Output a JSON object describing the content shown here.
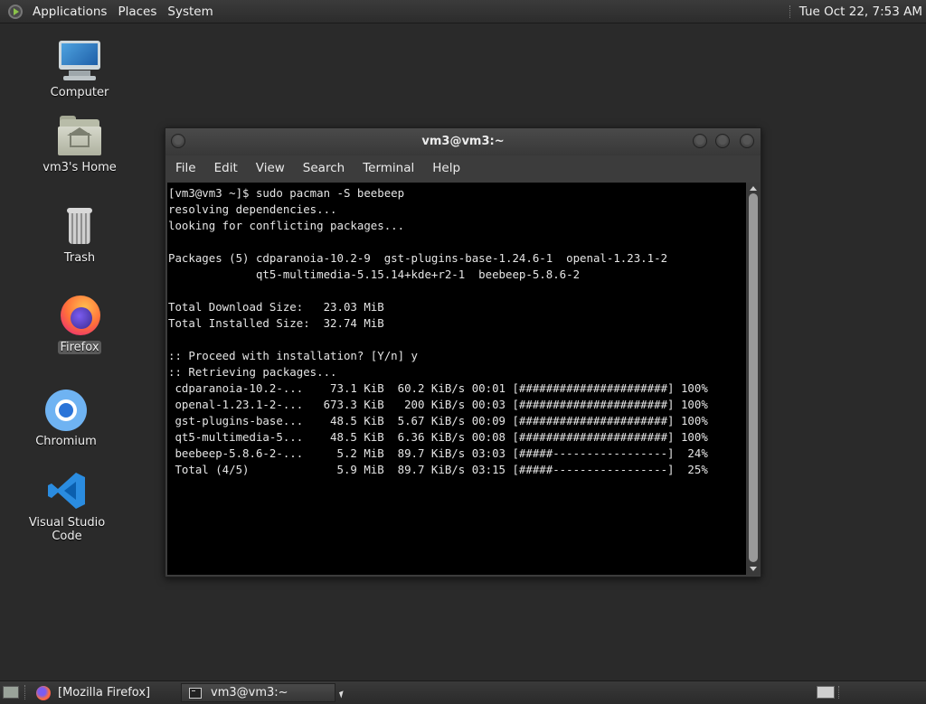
{
  "top_panel": {
    "menus": [
      "Applications",
      "Places",
      "System"
    ],
    "clock": "Tue Oct 22,  7:53 AM"
  },
  "desktop": {
    "icons": [
      {
        "label": "Computer",
        "icon": "computer-icon"
      },
      {
        "label": "vm3's Home",
        "icon": "home-folder-icon"
      },
      {
        "label": "Trash",
        "icon": "trash-icon"
      },
      {
        "label": "Firefox",
        "icon": "firefox-icon"
      },
      {
        "label": "Chromium",
        "icon": "chromium-icon"
      },
      {
        "label": "Visual Studio Code",
        "icon": "vscode-icon"
      }
    ]
  },
  "terminal": {
    "title": "vm3@vm3:~",
    "menu": [
      "File",
      "Edit",
      "View",
      "Search",
      "Terminal",
      "Help"
    ],
    "lines": [
      "[vm3@vm3 ~]$ sudo pacman -S beebeep",
      "resolving dependencies...",
      "looking for conflicting packages...",
      "",
      "Packages (5) cdparanoia-10.2-9  gst-plugins-base-1.24.6-1  openal-1.23.1-2",
      "             qt5-multimedia-5.15.14+kde+r2-1  beebeep-5.8.6-2",
      "",
      "Total Download Size:   23.03 MiB",
      "Total Installed Size:  32.74 MiB",
      "",
      ":: Proceed with installation? [Y/n] y",
      ":: Retrieving packages...",
      " cdparanoia-10.2-...    73.1 KiB  60.2 KiB/s 00:01 [######################] 100%",
      " openal-1.23.1-2-...   673.3 KiB   200 KiB/s 00:03 [######################] 100%",
      " gst-plugins-base...    48.5 KiB  5.67 KiB/s 00:09 [######################] 100%",
      " qt5-multimedia-5...    48.5 KiB  6.36 KiB/s 00:08 [######################] 100%",
      " beebeep-5.8.6-2-...     5.2 MiB  89.7 KiB/s 03:03 [#####-----------------]  24%",
      " Total (4/5)             5.9 MiB  89.7 KiB/s 03:15 [#####-----------------]  25%"
    ]
  },
  "taskbar": {
    "tasks": [
      {
        "label": "[Mozilla Firefox]",
        "icon": "firefox-icon",
        "active": false
      },
      {
        "label": "vm3@vm3:~",
        "icon": "terminal-icon",
        "active": true
      }
    ]
  }
}
